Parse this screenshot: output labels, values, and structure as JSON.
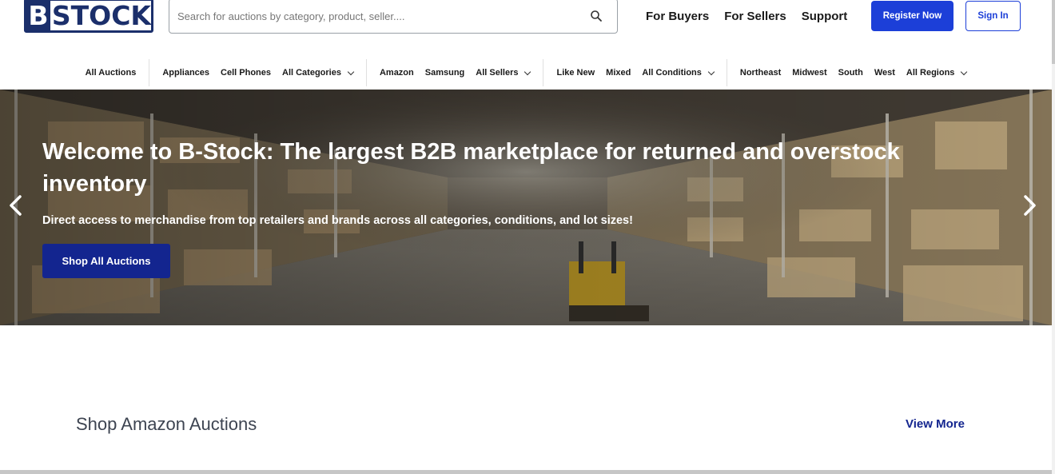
{
  "header": {
    "logo": {
      "letter": "B",
      "rest": "STOCK"
    },
    "search": {
      "placeholder": "Search for auctions by category, product, seller...."
    },
    "links": [
      "For Buyers",
      "For Sellers",
      "Support"
    ],
    "register_label": "Register Now",
    "signin_label": "Sign In",
    "accent_color": "#1c3fd8"
  },
  "nav": {
    "groups": [
      {
        "items": [
          {
            "label": "All Auctions",
            "dropdown": false
          }
        ]
      },
      {
        "items": [
          {
            "label": "Appliances",
            "dropdown": false
          },
          {
            "label": "Cell Phones",
            "dropdown": false
          },
          {
            "label": "All Categories",
            "dropdown": true
          }
        ]
      },
      {
        "items": [
          {
            "label": "Amazon",
            "dropdown": false
          },
          {
            "label": "Samsung",
            "dropdown": false
          },
          {
            "label": "All Sellers",
            "dropdown": true
          }
        ]
      },
      {
        "items": [
          {
            "label": "Like New",
            "dropdown": false
          },
          {
            "label": "Mixed",
            "dropdown": false
          },
          {
            "label": "All Conditions",
            "dropdown": true
          }
        ]
      },
      {
        "items": [
          {
            "label": "Northeast",
            "dropdown": false
          },
          {
            "label": "Midwest",
            "dropdown": false
          },
          {
            "label": "South",
            "dropdown": false
          },
          {
            "label": "West",
            "dropdown": false
          },
          {
            "label": "All Regions",
            "dropdown": true
          }
        ]
      }
    ]
  },
  "hero": {
    "title": "Welcome to B-Stock: The largest B2B marketplace for returned and overstock inventory",
    "subtitle": "Direct access to merchandise from top retailers and brands across all categories, conditions, and lot sizes!",
    "cta_label": "Shop All Auctions",
    "cta_color": "#13258f"
  },
  "section": {
    "title": "Shop Amazon Auctions",
    "view_more_label": "View More"
  }
}
